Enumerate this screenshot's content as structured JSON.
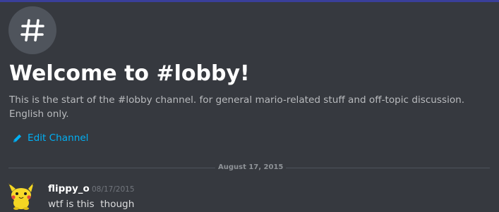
{
  "channel": {
    "icon": "hashtag-icon",
    "welcome_title": "Welcome to #lobby!",
    "description": "This is the start of the #lobby channel. for general mario-related stuff and off-topic discussion. English only.",
    "edit_label": "Edit Channel",
    "edit_icon": "pencil-icon"
  },
  "divider": {
    "date": "August 17, 2015"
  },
  "message": {
    "avatar_icon": "pikachu-avatar",
    "author": "flippy_o",
    "timestamp": "08/17/2015",
    "content": "wtf is this  though"
  },
  "colors": {
    "background": "#36393f",
    "link": "#00b0f4",
    "accent_top": "#3a3f9a"
  }
}
